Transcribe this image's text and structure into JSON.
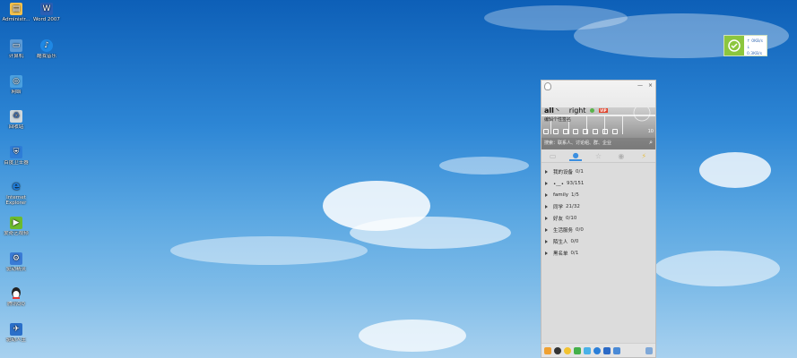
{
  "desktop": {
    "icons": [
      {
        "label": "Administr...",
        "icon": "folder-user-icon",
        "color": "#f2c14e"
      },
      {
        "label": "Word 2007",
        "icon": "word-icon",
        "color": "#2b5fb4"
      },
      {
        "label": "计算机",
        "icon": "computer-icon",
        "color": "#5b9ad6"
      },
      {
        "label": "酷我音乐",
        "icon": "music-icon",
        "color": "#1e88e5"
      },
      {
        "label": "网络",
        "icon": "network-icon",
        "color": "#4aa0e0"
      },
      {
        "label": "回收站",
        "icon": "recycle-bin-icon",
        "color": "#cfd8dc"
      },
      {
        "label": "百度卫士器",
        "icon": "guard-icon",
        "color": "#2e7dd7"
      },
      {
        "label": "Internet Explorer",
        "icon": "ie-icon",
        "color": "#1e7fe0"
      },
      {
        "label": "爱奇艺视频",
        "icon": "video-icon",
        "color": "#6dbb2d"
      },
      {
        "label": "驱动精灵",
        "icon": "driver-icon",
        "color": "#3a7bd5"
      },
      {
        "label": "腾讯QQ",
        "icon": "qq-penguin-icon",
        "color": "#222222"
      },
      {
        "label": "驱动人生",
        "icon": "plane-icon",
        "color": "#2a6fc9"
      }
    ]
  },
  "speed": {
    "up": "↑ 0KB/s",
    "down": "↓ 0.3KB/s",
    "badge_color": "#8cc63e"
  },
  "qq": {
    "name": "all",
    "name_suffix": "right",
    "vip": "VIP",
    "signature": "编辑个性签名",
    "search_placeholder": "搜索：联系人、讨论组、群、企业",
    "tool_count": "10",
    "window_controls": [
      "—",
      "×"
    ],
    "groups": [
      {
        "name": "我的设备",
        "count": "0/1"
      },
      {
        "name": "•﹏•",
        "count": "93/151"
      },
      {
        "name": "family",
        "count": "1/5"
      },
      {
        "name": "同学",
        "count": "21/32"
      },
      {
        "name": "好友",
        "count": "0/10"
      },
      {
        "name": "生活服务",
        "count": "0/0"
      },
      {
        "name": "陌生人",
        "count": "0/0"
      },
      {
        "name": "黑名单",
        "count": "0/1"
      }
    ]
  }
}
